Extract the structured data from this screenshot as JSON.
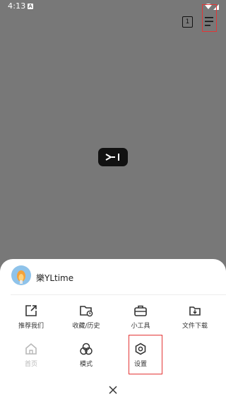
{
  "status_bar": {
    "time": "4:13",
    "notification_letter": "A"
  },
  "toolbar": {
    "tab_count": "1"
  },
  "profile": {
    "username": "樂YLtime"
  },
  "menu": {
    "row1": [
      {
        "label": "推荐我们",
        "icon": "share-icon"
      },
      {
        "label": "收藏/历史",
        "icon": "folder-clock-icon"
      },
      {
        "label": "小工具",
        "icon": "toolbox-icon"
      },
      {
        "label": "文件下载",
        "icon": "file-download-icon"
      }
    ],
    "row2": [
      {
        "label": "首页",
        "icon": "home-icon",
        "state": "disabled"
      },
      {
        "label": "模式",
        "icon": "mode-circles-icon"
      },
      {
        "label": "设置",
        "icon": "settings-hexagon-icon",
        "highlighted": true
      }
    ]
  },
  "colors": {
    "backdrop": "#787878",
    "highlight": "#e33636",
    "avatar_bg": "#8fc3ea"
  }
}
